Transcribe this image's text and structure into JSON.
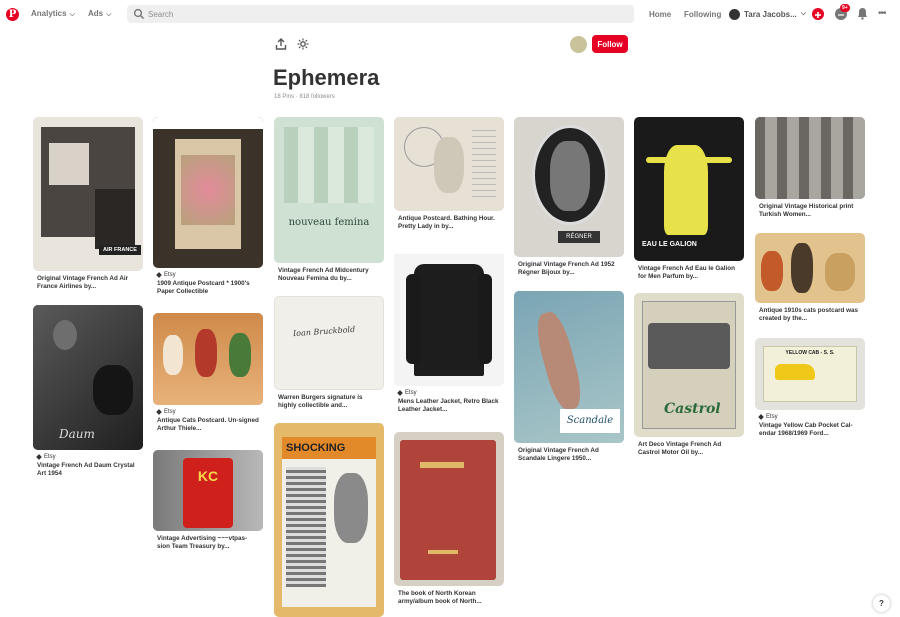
{
  "topbar": {
    "logo": "P",
    "nav": [
      "Analytics",
      "Ads"
    ],
    "search_placeholder": "Search",
    "links": [
      "Home",
      "Following"
    ],
    "profile_name": "Tara Jacobs...",
    "notif_count": "9+",
    "more": "•••"
  },
  "board": {
    "title": "Ephemera",
    "pins_count": "18 Pins",
    "separator": "·",
    "followers": "818 followers",
    "follow_label": "Follow"
  },
  "pins": [
    {
      "caption": "Original Vintage French Ad Air France Airlines by...",
      "source": "",
      "bg": "#e9e4dc"
    },
    {
      "caption": "Vintage French Ad Daum Crystal Art 1954",
      "source": "Etsy",
      "bg": "#3a3a3a"
    },
    {
      "caption": "1909 Antique Postcard * 1900's Paper Collectible",
      "source": "Etsy",
      "bg": "#3b3229"
    },
    {
      "caption": "Antique Cats Postcard. Un-signed Arthur Thiele...",
      "source": "Etsy",
      "bg": "#d89a5a"
    },
    {
      "caption": "Vintage Advertising ~~~vtpas-sion Team Treasury by...",
      "source": "",
      "bg": "#9a9a9a"
    },
    {
      "caption": "Vintage French Ad Midcentury Nouveau Femina du by...",
      "source": "",
      "bg": "#cfe1d2"
    },
    {
      "caption": "Warren Burgers signature is highly collectible and...",
      "source": "",
      "bg": "#f1efe9"
    },
    {
      "caption": "",
      "source": "",
      "bg": "#e4b96a"
    },
    {
      "caption": "Antique Postcard. Bathing Hour. Pretty Lady in by...",
      "source": "",
      "bg": "#e7e1d5"
    },
    {
      "caption": "Mens Leather Jacket, Retro Black Leather Jacket...",
      "source": "Etsy",
      "bg": "#f4f4f4"
    },
    {
      "caption": "The book of North Korean army/album book of North...",
      "source": "",
      "bg": "#a24a3a"
    },
    {
      "caption": "Original Vintage French Ad 1952 Régner Bijoux by...",
      "source": "",
      "bg": "#d8d5cf"
    },
    {
      "caption": "Original Vintage French Ad Scandale Lingere 1950...",
      "source": "",
      "bg": "#8fb3bf"
    },
    {
      "caption": "Vintage French Ad Eau le Galion for Men Parfum by...",
      "source": "",
      "bg": "#1a1a1a"
    },
    {
      "caption": "Art Deco Vintage French Ad Castrol Motor Oil by...",
      "source": "",
      "bg": "#e1ddcb"
    },
    {
      "caption": "Original Vintage Historical print Turkish Women...",
      "source": "",
      "bg": "#8d8a86"
    },
    {
      "caption": "Antique 1910s cats postcard was created by the...",
      "source": "",
      "bg": "#e2c38e"
    },
    {
      "caption": "Vintage Yellow Cab Pocket Cal-endar 1968/1969 Ford...",
      "source": "Etsy",
      "bg": "#e3e2dc"
    }
  ],
  "art": {
    "air_france": "AIR FRANCE",
    "daum": "Daum",
    "kc": "KC",
    "femina": "nouveau femina",
    "signature": "Ioan Bruckbold",
    "shocking": "SHOCKING",
    "regner": "RÉGNER",
    "scandale": "Scandale",
    "galion": "EAU LE GALION",
    "castrol": "Castrol",
    "cab": "YELLOW CAB - S. S."
  },
  "help": "?"
}
